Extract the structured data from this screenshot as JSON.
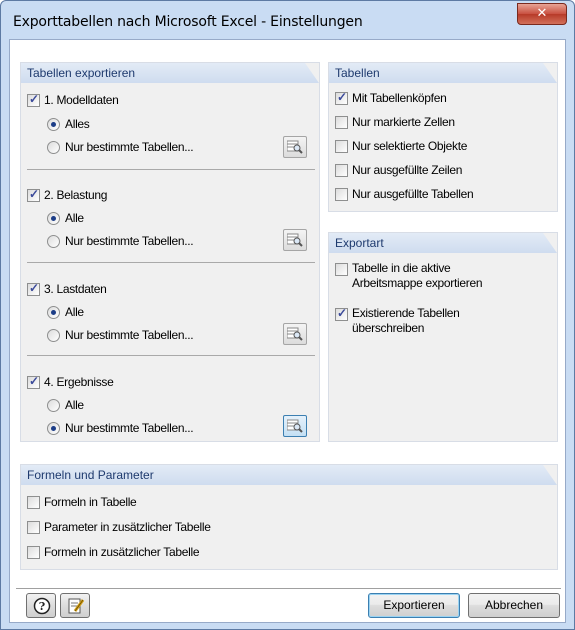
{
  "window": {
    "title": "Exporttabellen nach Microsoft Excel - Einstellungen",
    "close_glyph": "✕"
  },
  "export_group": {
    "title": "Tabellen exportieren",
    "sections": [
      {
        "label": "1. Modelldaten",
        "checked": true,
        "opt_all": "Alles",
        "opt_specific": "Nur bestimmte Tabellen...",
        "selected": "all"
      },
      {
        "label": "2. Belastung",
        "checked": true,
        "opt_all": "Alle",
        "opt_specific": "Nur bestimmte Tabellen...",
        "selected": "all"
      },
      {
        "label": "3. Lastdaten",
        "checked": true,
        "opt_all": "Alle",
        "opt_specific": "Nur bestimmte Tabellen...",
        "selected": "all"
      },
      {
        "label": "4. Ergebnisse",
        "checked": true,
        "opt_all": "Alle",
        "opt_specific": "Nur bestimmte Tabellen...",
        "selected": "specific"
      }
    ]
  },
  "tables_group": {
    "title": "Tabellen",
    "options": [
      {
        "label": "Mit Tabellenköpfen",
        "checked": true
      },
      {
        "label": "Nur markierte Zellen",
        "checked": false
      },
      {
        "label": "Nur selektierte Objekte",
        "checked": false
      },
      {
        "label": "Nur ausgefüllte Zeilen",
        "checked": false
      },
      {
        "label": "Nur ausgefüllte Tabellen",
        "checked": false
      }
    ]
  },
  "export_type_group": {
    "title": "Exportart",
    "options": [
      {
        "line1": "Tabelle in die aktive",
        "line2": "Arbeitsmappe exportieren",
        "checked": false
      },
      {
        "line1": "Existierende Tabellen",
        "line2": "überschreiben",
        "checked": true
      }
    ]
  },
  "formulas_group": {
    "title": "Formeln und Parameter",
    "options": [
      {
        "label": "Formeln in Tabelle",
        "checked": false
      },
      {
        "label": "Parameter in zusätzlicher Tabelle",
        "checked": false
      },
      {
        "label": "Formeln in zusätzlicher Tabelle",
        "checked": false
      }
    ]
  },
  "footer": {
    "help_icon": "help-icon",
    "edit_icon": "edit-icon",
    "export_label": "Exportieren",
    "cancel_label": "Abbrechen"
  }
}
